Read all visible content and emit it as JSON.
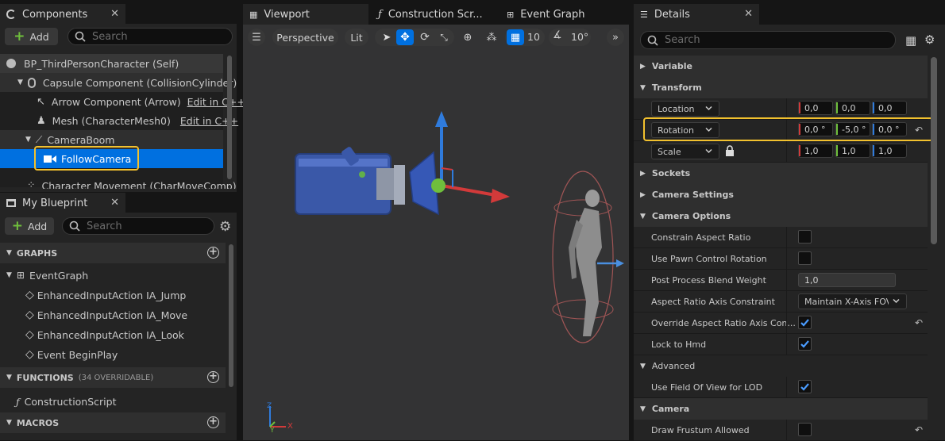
{
  "components_panel": {
    "tab_title": "Components",
    "add_label": "Add",
    "search_placeholder": "Search",
    "tree": [
      {
        "label": "BP_ThirdPersonCharacter (Self)"
      },
      {
        "label": "Capsule Component (CollisionCylinder)"
      },
      {
        "label": "Arrow Component (Arrow)",
        "link": "Edit in C++"
      },
      {
        "label": "Mesh (CharacterMesh0)",
        "link": "Edit in C++"
      },
      {
        "label": "CameraBoom"
      },
      {
        "label": "FollowCamera",
        "selected": true
      },
      {
        "label": "Character Movement (CharMoveComp)"
      }
    ]
  },
  "my_blueprint_panel": {
    "tab_title": "My Blueprint",
    "add_label": "Add",
    "search_placeholder": "Search",
    "sections": {
      "graphs_label": "GRAPHS",
      "functions_label": "FUNCTIONS",
      "functions_note": "(34 OVERRIDABLE)",
      "macros_label": "MACROS"
    },
    "event_graph_label": "EventGraph",
    "events": [
      "EnhancedInputAction IA_Jump",
      "EnhancedInputAction IA_Move",
      "EnhancedInputAction IA_Look",
      "Event BeginPlay"
    ],
    "functions": [
      "ConstructionScript"
    ]
  },
  "editor_tabs": {
    "viewport": "Viewport",
    "construction": "Construction Scr...",
    "event_graph": "Event Graph"
  },
  "viewport_toolbar": {
    "view_mode": "Perspective",
    "lighting": "Lit",
    "grid_snap": "10",
    "rotation_snap": "10°"
  },
  "axis_labels": {
    "x": "X",
    "y": "Y",
    "z": "Z"
  },
  "details_panel": {
    "tab_title": "Details",
    "search_placeholder": "Search",
    "categories": {
      "variable": "Variable",
      "transform": "Transform",
      "sockets": "Sockets",
      "camera_settings": "Camera Settings",
      "camera_options": "Camera Options",
      "advanced": "Advanced",
      "camera": "Camera"
    },
    "transform": {
      "location": {
        "label": "Location",
        "x": "0,0",
        "y": "0,0",
        "z": "0,0"
      },
      "rotation": {
        "label": "Rotation",
        "x": "0,0 °",
        "y": "-5,0 °",
        "z": "0,0 °"
      },
      "scale": {
        "label": "Scale",
        "x": "1,0",
        "y": "1,0",
        "z": "1,0"
      }
    },
    "camera_options": {
      "constrain_aspect_ratio": {
        "label": "Constrain Aspect Ratio",
        "checked": false
      },
      "use_pawn_control_rotation": {
        "label": "Use Pawn Control Rotation",
        "checked": false
      },
      "post_process_blend_weight": {
        "label": "Post Process Blend Weight",
        "value": "1,0"
      },
      "aspect_ratio_axis_constraint": {
        "label": "Aspect Ratio Axis Constraint",
        "value": "Maintain X-Axis FOV"
      },
      "override_aspect_ratio_axis_constraint": {
        "label": "Override Aspect Ratio Axis Con...",
        "checked": true
      },
      "lock_to_hmd": {
        "label": "Lock to Hmd",
        "checked": true
      }
    },
    "advanced": {
      "use_fov_for_lod": {
        "label": "Use Field Of View for LOD",
        "checked": true
      }
    },
    "camera": {
      "draw_frustum_allowed": {
        "label": "Draw Frustum Allowed",
        "checked": false
      }
    }
  },
  "colors": {
    "accent_blue": "#0070e0",
    "highlight_yellow": "#f2c12e",
    "axis_red": "#d23a3a",
    "axis_green": "#6fbf3c",
    "axis_blue": "#2f7bdc"
  }
}
